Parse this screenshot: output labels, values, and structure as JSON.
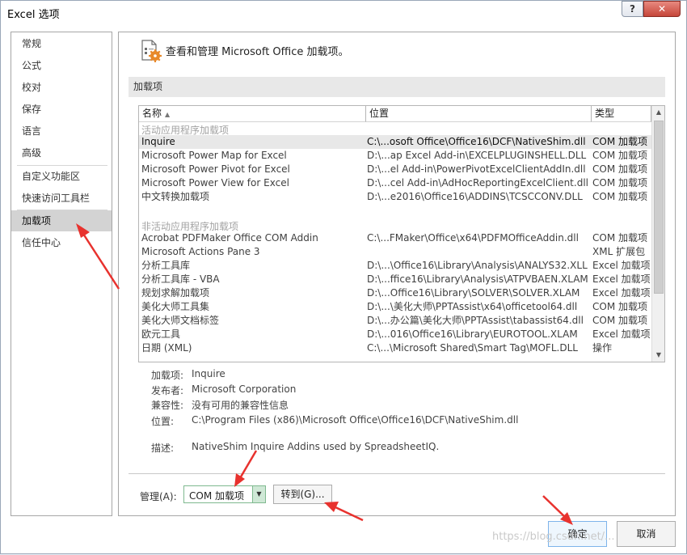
{
  "window": {
    "title": "Excel 选项",
    "help_symbol": "?",
    "close_symbol": "✕"
  },
  "nav": {
    "items": [
      "常规",
      "公式",
      "校对",
      "保存",
      "语言",
      "高级",
      "自定义功能区",
      "快速访问工具栏",
      "加载项",
      "信任中心"
    ],
    "active_index": 8
  },
  "header": {
    "text": "查看和管理 Microsoft Office 加载项。",
    "icon": "addins-gear-icon"
  },
  "section_title": "加载项",
  "table": {
    "columns": [
      "名称",
      "位置",
      "类型"
    ],
    "sort_indicator": "▲",
    "active_group": "活动应用程序加载项",
    "inactive_group": "非活动应用程序加载项",
    "active_rows": [
      [
        "Inquire",
        "C:\\...osoft Office\\Office16\\DCF\\NativeShim.dll",
        "COM 加载项"
      ],
      [
        "Microsoft Power Map for Excel",
        "D:\\...ap Excel Add-in\\EXCELPLUGINSHELL.DLL",
        "COM 加载项"
      ],
      [
        "Microsoft Power Pivot for Excel",
        "D:\\...el Add-in\\PowerPivotExcelClientAddIn.dll",
        "COM 加载项"
      ],
      [
        "Microsoft Power View for Excel",
        "D:\\...cel Add-in\\AdHocReportingExcelClient.dll",
        "COM 加载项"
      ],
      [
        "中文转换加载项",
        "D:\\...e2016\\Office16\\ADDINS\\TCSCCONV.DLL",
        "COM 加载项"
      ]
    ],
    "inactive_rows": [
      [
        "Acrobat PDFMaker Office COM Addin",
        "C:\\...FMaker\\Office\\x64\\PDFMOfficeAddin.dll",
        "COM 加载项"
      ],
      [
        "Microsoft Actions Pane 3",
        "",
        "XML 扩展包"
      ],
      [
        "分析工具库",
        "D:\\...\\Office16\\Library\\Analysis\\ANALYS32.XLL",
        "Excel 加载项"
      ],
      [
        "分析工具库 - VBA",
        "D:\\...ffice16\\Library\\Analysis\\ATPVBAEN.XLAM",
        "Excel 加载项"
      ],
      [
        "规划求解加载项",
        "D:\\...Office16\\Library\\SOLVER\\SOLVER.XLAM",
        "Excel 加载项"
      ],
      [
        "美化大师工具集",
        "D:\\...\\美化大师\\PPTAssist\\x64\\officetool64.dll",
        "COM 加载项"
      ],
      [
        "美化大师文档标签",
        "D:\\...办公篇\\美化大师\\PPTAssist\\tabassist64.dll",
        "COM 加载项"
      ],
      [
        "欧元工具",
        "D:\\...016\\Office16\\Library\\EUROTOOL.XLAM",
        "Excel 加载项"
      ],
      [
        "日期 (XML)",
        "C:\\...\\Microsoft Shared\\Smart Tag\\MOFL.DLL",
        "操作"
      ]
    ],
    "selected_row": "Inquire"
  },
  "details": {
    "addin_label": "加载项:",
    "addin_value": "Inquire",
    "publisher_label": "发布者:",
    "publisher_value": "Microsoft Corporation",
    "compat_label": "兼容性:",
    "compat_value": "没有可用的兼容性信息",
    "location_label": "位置:",
    "location_value": "C:\\Program Files (x86)\\Microsoft Office\\Office16\\DCF\\NativeShim.dll",
    "desc_label": "描述:",
    "desc_value": "NativeShim Inquire Addins used by SpreadsheetIQ."
  },
  "manage": {
    "label": "管理(A):",
    "selected": "COM 加载项",
    "goto_label": "转到(G)..."
  },
  "buttons": {
    "ok": "确定",
    "cancel": "取消"
  },
  "watermark": "https://blog.csdn.net/...",
  "colors": {
    "annotation_arrow": "#e8322e",
    "selected_nav": "#d3d3d3",
    "ok_border": "#7eb4ea"
  }
}
